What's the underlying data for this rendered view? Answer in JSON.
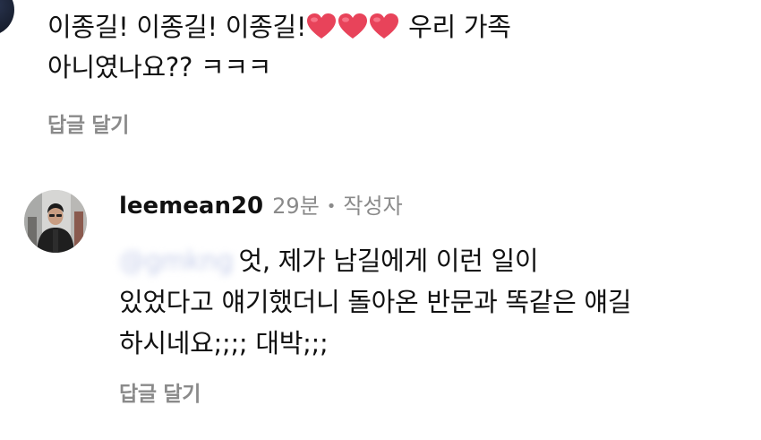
{
  "comment1": {
    "text_a": "이종길! 이종길! 이종길!",
    "text_b": " 우리 가족",
    "line2": "아니였나요?? ㅋㅋㅋ",
    "hearts": [
      "heart-icon",
      "heart-icon",
      "heart-icon"
    ],
    "reply_label": "답글 달기"
  },
  "reply": {
    "username": "leemean20",
    "time": "29분",
    "separator": "•",
    "author_badge": "작성자",
    "mention": "@gmkng",
    "text_line1": "엇, 제가 남길에게 이런 일이",
    "text_line2": "있었다고 얘기했더니 돌아온 반문과 똑같은 얘길",
    "text_line3": "하시네요;;;; 대박;;;",
    "reply_label": "답글 달기"
  },
  "colors": {
    "text": "#111111",
    "muted": "#8a8a8a",
    "heart": "#e8435a"
  }
}
